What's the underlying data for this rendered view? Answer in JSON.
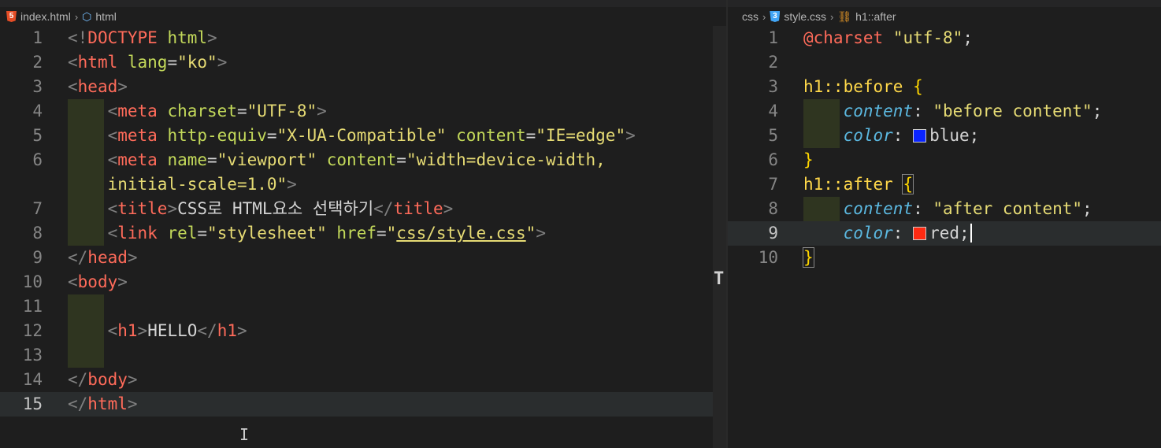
{
  "left_pane": {
    "breadcrumb": {
      "file": "index.html",
      "symbol": "html"
    },
    "icons": {
      "file": "html5-icon",
      "symbol": "cube-icon"
    },
    "lines": [
      {
        "n": "1",
        "tokens": [
          [
            "br",
            "<!"
          ],
          [
            "kw",
            "DOCTYPE"
          ],
          [
            "attr",
            " html"
          ],
          [
            "br",
            ">"
          ]
        ]
      },
      {
        "n": "2",
        "tokens": [
          [
            "br",
            "<"
          ],
          [
            "tag",
            "html"
          ],
          [
            "attr",
            " lang"
          ],
          [
            "plain",
            "="
          ],
          [
            "val",
            "\"ko\""
          ],
          [
            "br",
            ">"
          ]
        ]
      },
      {
        "n": "3",
        "tokens": [
          [
            "br",
            "<"
          ],
          [
            "tag",
            "head"
          ],
          [
            "br",
            ">"
          ]
        ]
      },
      {
        "n": "4",
        "tokens": [
          [
            "plain",
            "    "
          ],
          [
            "br",
            "<"
          ],
          [
            "tag",
            "meta"
          ],
          [
            "attr",
            " charset"
          ],
          [
            "plain",
            "="
          ],
          [
            "val",
            "\"UTF-8\""
          ],
          [
            "br",
            ">"
          ]
        ]
      },
      {
        "n": "5",
        "tokens": [
          [
            "plain",
            "    "
          ],
          [
            "br",
            "<"
          ],
          [
            "tag",
            "meta"
          ],
          [
            "attr",
            " http-equiv"
          ],
          [
            "plain",
            "="
          ],
          [
            "val",
            "\"X-UA-Compatible\""
          ],
          [
            "attr",
            " content"
          ],
          [
            "plain",
            "="
          ],
          [
            "val",
            "\"IE=edge\""
          ],
          [
            "br",
            ">"
          ]
        ]
      },
      {
        "n": "6",
        "tokens": [
          [
            "plain",
            "    "
          ],
          [
            "br",
            "<"
          ],
          [
            "tag",
            "meta"
          ],
          [
            "attr",
            " name"
          ],
          [
            "plain",
            "="
          ],
          [
            "val",
            "\"viewport\""
          ],
          [
            "attr",
            " content"
          ],
          [
            "plain",
            "="
          ],
          [
            "val",
            "\"width=device-width,"
          ]
        ]
      },
      {
        "n": "",
        "tokens": [
          [
            "plain",
            "    "
          ],
          [
            "val",
            "initial-scale=1.0\""
          ],
          [
            "br",
            ">"
          ]
        ]
      },
      {
        "n": "7",
        "tokens": [
          [
            "plain",
            "    "
          ],
          [
            "br",
            "<"
          ],
          [
            "tag",
            "title"
          ],
          [
            "br",
            ">"
          ],
          [
            "plain",
            "CSS로 HTML요소 선택하기"
          ],
          [
            "br",
            "</"
          ],
          [
            "tag",
            "title"
          ],
          [
            "br",
            ">"
          ]
        ]
      },
      {
        "n": "8",
        "tokens": [
          [
            "plain",
            "    "
          ],
          [
            "br",
            "<"
          ],
          [
            "tag",
            "link"
          ],
          [
            "attr",
            " rel"
          ],
          [
            "plain",
            "="
          ],
          [
            "val",
            "\"stylesheet\""
          ],
          [
            "attr",
            " href"
          ],
          [
            "plain",
            "="
          ],
          [
            "val",
            "\""
          ],
          [
            "valu",
            "css/style.css"
          ],
          [
            "val",
            "\""
          ],
          [
            "br",
            ">"
          ]
        ]
      },
      {
        "n": "9",
        "tokens": [
          [
            "br",
            "</"
          ],
          [
            "tag",
            "head"
          ],
          [
            "br",
            ">"
          ]
        ]
      },
      {
        "n": "10",
        "tokens": [
          [
            "br",
            "<"
          ],
          [
            "tag",
            "body"
          ],
          [
            "br",
            ">"
          ]
        ]
      },
      {
        "n": "11",
        "tokens": []
      },
      {
        "n": "12",
        "tokens": [
          [
            "plain",
            "    "
          ],
          [
            "br",
            "<"
          ],
          [
            "tag",
            "h1"
          ],
          [
            "br",
            ">"
          ],
          [
            "plain",
            "HELLO"
          ],
          [
            "br",
            "</"
          ],
          [
            "tag",
            "h1"
          ],
          [
            "br",
            ">"
          ]
        ]
      },
      {
        "n": "13",
        "tokens": []
      },
      {
        "n": "14",
        "tokens": [
          [
            "br",
            "</"
          ],
          [
            "tag",
            "body"
          ],
          [
            "br",
            ">"
          ]
        ]
      },
      {
        "n": "15",
        "tokens": [
          [
            "br",
            "</"
          ],
          [
            "tag",
            "html"
          ],
          [
            "br",
            ">"
          ]
        ]
      }
    ]
  },
  "right_pane": {
    "breadcrumb": {
      "folder": "css",
      "file": "style.css",
      "symbol": "h1::after"
    },
    "icons": {
      "file": "css3-icon",
      "symbol": "selector-icon"
    },
    "lines": [
      {
        "n": "1",
        "tokens": [
          [
            "atrule",
            "@charset"
          ],
          [
            "plain",
            " "
          ],
          [
            "str",
            "\"utf-8\""
          ],
          [
            "plain",
            ";"
          ]
        ]
      },
      {
        "n": "2",
        "tokens": []
      },
      {
        "n": "3",
        "tokens": [
          [
            "sel",
            "h1::before"
          ],
          [
            "plain",
            " "
          ],
          [
            "brace",
            "{"
          ]
        ]
      },
      {
        "n": "4",
        "tokens": [
          [
            "plain",
            "    "
          ],
          [
            "prop",
            "content"
          ],
          [
            "plain",
            ": "
          ],
          [
            "str",
            "\"before content\""
          ],
          [
            "plain",
            ";"
          ]
        ]
      },
      {
        "n": "5",
        "tokens": [
          [
            "plain",
            "    "
          ],
          [
            "prop",
            "color"
          ],
          [
            "plain",
            ": "
          ],
          [
            "swatch",
            "#0a24ff"
          ],
          [
            "plain",
            "blue;"
          ]
        ]
      },
      {
        "n": "6",
        "tokens": [
          [
            "brace",
            "}"
          ]
        ]
      },
      {
        "n": "7",
        "tokens": [
          [
            "sel",
            "h1::after"
          ],
          [
            "plain",
            " "
          ],
          [
            "brace2",
            "{"
          ]
        ]
      },
      {
        "n": "8",
        "tokens": [
          [
            "plain",
            "    "
          ],
          [
            "prop",
            "content"
          ],
          [
            "plain",
            ": "
          ],
          [
            "str",
            "\"after content\""
          ],
          [
            "plain",
            ";"
          ]
        ]
      },
      {
        "n": "9",
        "tokens": [
          [
            "plain",
            "    "
          ],
          [
            "prop",
            "color"
          ],
          [
            "plain",
            ": "
          ],
          [
            "swatch",
            "#ff2a12"
          ],
          [
            "plain",
            "red;"
          ],
          [
            "cursor",
            ""
          ]
        ]
      },
      {
        "n": "10",
        "tokens": [
          [
            "brace2",
            "}"
          ]
        ]
      }
    ]
  },
  "active_lines": {
    "left": "15",
    "right": "9"
  },
  "colors": {
    "background": "#1e1e1e",
    "tag": "#ff6b5a",
    "attribute": "#c3d95a",
    "string": "#e6db74",
    "property": "#5bb8e0",
    "selector": "#ffd84a"
  }
}
